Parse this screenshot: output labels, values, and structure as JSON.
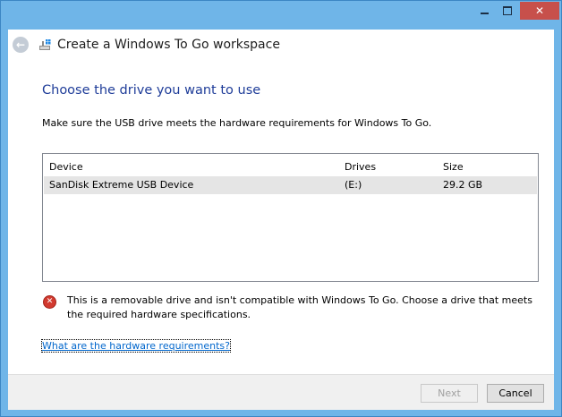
{
  "window": {
    "title": "Create a Windows To Go workspace",
    "icons": {
      "back": "back-arrow-icon",
      "app": "windows-to-go-icon"
    }
  },
  "page": {
    "heading": "Choose the drive you want to use",
    "description": "Make sure the USB drive meets the hardware requirements for Windows To Go."
  },
  "drive_list": {
    "columns": [
      "Device",
      "Drives",
      "Size"
    ],
    "rows": [
      {
        "device": "SanDisk Extreme USB Device",
        "drive": "(E:)",
        "size": "29.2 GB"
      }
    ]
  },
  "error": {
    "icon": "error-icon",
    "message": "This is a removable drive and isn't compatible with Windows To Go. Choose a drive that meets the required hardware specifications."
  },
  "link": {
    "text": "What are the hardware requirements?"
  },
  "buttons": {
    "next": "Next",
    "cancel": "Cancel"
  },
  "colors": {
    "heading": "#1f3d99",
    "link": "#0066cc",
    "close": "#c7504b",
    "frame": "#6fb5e8"
  }
}
